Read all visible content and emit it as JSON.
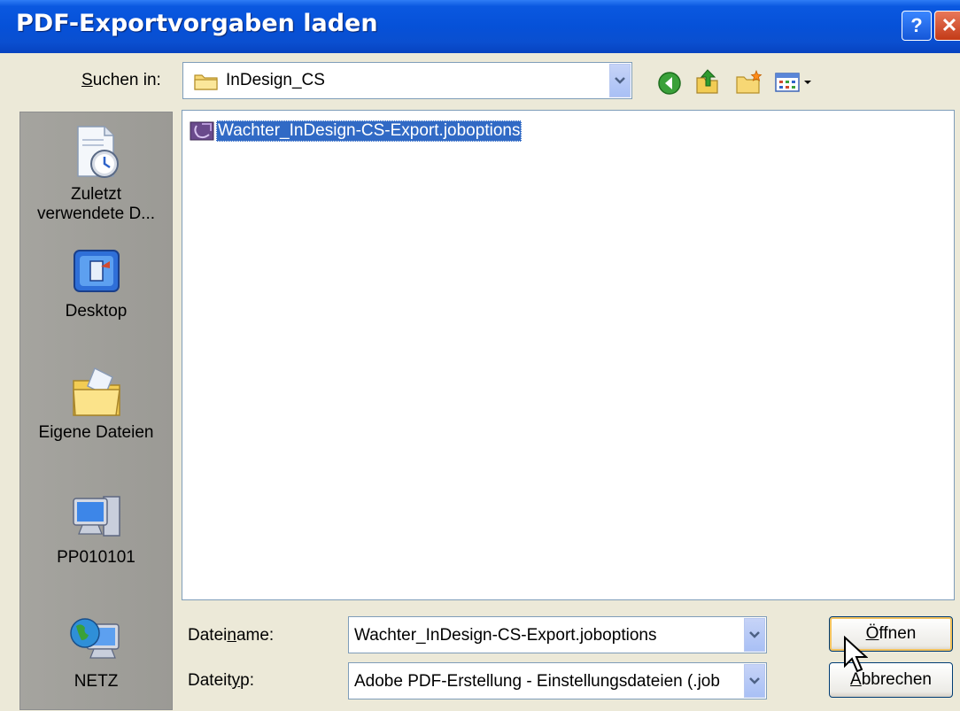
{
  "window": {
    "title": "PDF-Exportvorgaben laden",
    "help_label": "?",
    "close_label": "✕"
  },
  "look_in": {
    "label_prefix": "S",
    "label_rest": "uchen in:",
    "value": "InDesign_CS"
  },
  "toolbar": {
    "icons": [
      "back-icon",
      "up-folder-icon",
      "new-folder-icon",
      "view-menu-icon"
    ]
  },
  "places": [
    {
      "label_line1": "Zuletzt",
      "label_line2": "verwendete D...",
      "icon": "recent-documents-icon"
    },
    {
      "label_line1": "Desktop",
      "label_line2": "",
      "icon": "desktop-icon"
    },
    {
      "label_line1": "Eigene Dateien",
      "label_line2": "",
      "icon": "my-documents-icon"
    },
    {
      "label_line1": "PP010101",
      "label_line2": "",
      "icon": "my-computer-icon"
    },
    {
      "label_line1": "NETZ",
      "label_line2": "",
      "icon": "network-icon"
    }
  ],
  "files": [
    {
      "name": "Wachter_InDesign-CS-Export.joboptions",
      "selected": true
    }
  ],
  "filename": {
    "label_a": "Datei",
    "label_u": "n",
    "label_b": "ame:",
    "value": "Wachter_InDesign-CS-Export.joboptions"
  },
  "filetype": {
    "label_a": "Dateit",
    "label_u": "y",
    "label_b": "p:",
    "value": "Adobe PDF-Erstellung - Einstellungsdateien (.job"
  },
  "buttons": {
    "open_u": "Ö",
    "open_rest": "ffnen",
    "cancel_a": "A",
    "cancel_rest": "bbrechen"
  },
  "colors": {
    "titlebar": "#0651d8",
    "selection": "#316ac5",
    "dialog_bg": "#ece9d8"
  }
}
